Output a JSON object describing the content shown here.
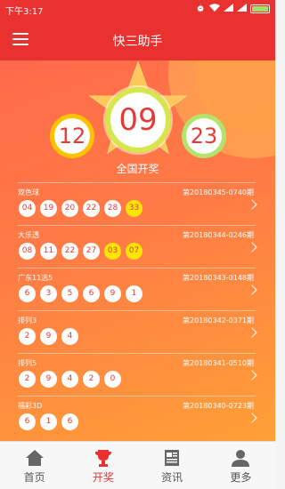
{
  "status_bar": {
    "time": "下午3:17",
    "icons": [
      "alarm-icon",
      "wifi-icon",
      "signal-icon",
      "signal-icon"
    ],
    "battery_color": "#9be36b"
  },
  "header": {
    "title": "快三助手",
    "menu_icon": "menu-icon",
    "background": "#e9322f"
  },
  "hero": {
    "center_number": "09",
    "left_number": "12",
    "right_number": "23",
    "label": "全国开奖"
  },
  "lotteries": [
    {
      "name": "双色球",
      "issue": "第20180345-0740期",
      "balls": [
        "04",
        "19",
        "20",
        "22",
        "28"
      ],
      "special_balls": [
        "33"
      ]
    },
    {
      "name": "大乐透",
      "issue": "第20180344-0246期",
      "balls": [
        "08",
        "11",
        "22",
        "27"
      ],
      "special_balls": [
        "03",
        "07"
      ]
    },
    {
      "name": "广东11选5",
      "issue": "第20180343-0148期",
      "balls": [
        "6",
        "3",
        "5",
        "6",
        "9",
        "1"
      ],
      "special_balls": []
    },
    {
      "name": "排列3",
      "issue": "第20180342-0371期",
      "balls": [
        "2",
        "9",
        "4"
      ],
      "special_balls": []
    },
    {
      "name": "排列5",
      "issue": "第20180341-0510期",
      "balls": [
        "2",
        "9",
        "4",
        "2",
        "0"
      ],
      "special_balls": []
    },
    {
      "name": "福彩3D",
      "issue": "第20180340-0723期",
      "balls": [
        "6",
        "1",
        "6"
      ],
      "special_balls": []
    }
  ],
  "tabs": [
    {
      "label": "首页",
      "icon": "home-icon",
      "active": false
    },
    {
      "label": "开奖",
      "icon": "trophy-icon",
      "active": true
    },
    {
      "label": "资讯",
      "icon": "news-icon",
      "active": false
    },
    {
      "label": "更多",
      "icon": "user-icon",
      "active": false
    }
  ],
  "colors": {
    "primary": "#e9322f",
    "ball_text": "#e53b35",
    "special_ball": "#ffe600",
    "gradient_start": "#ff6a4a",
    "gradient_end": "#ffa037"
  }
}
